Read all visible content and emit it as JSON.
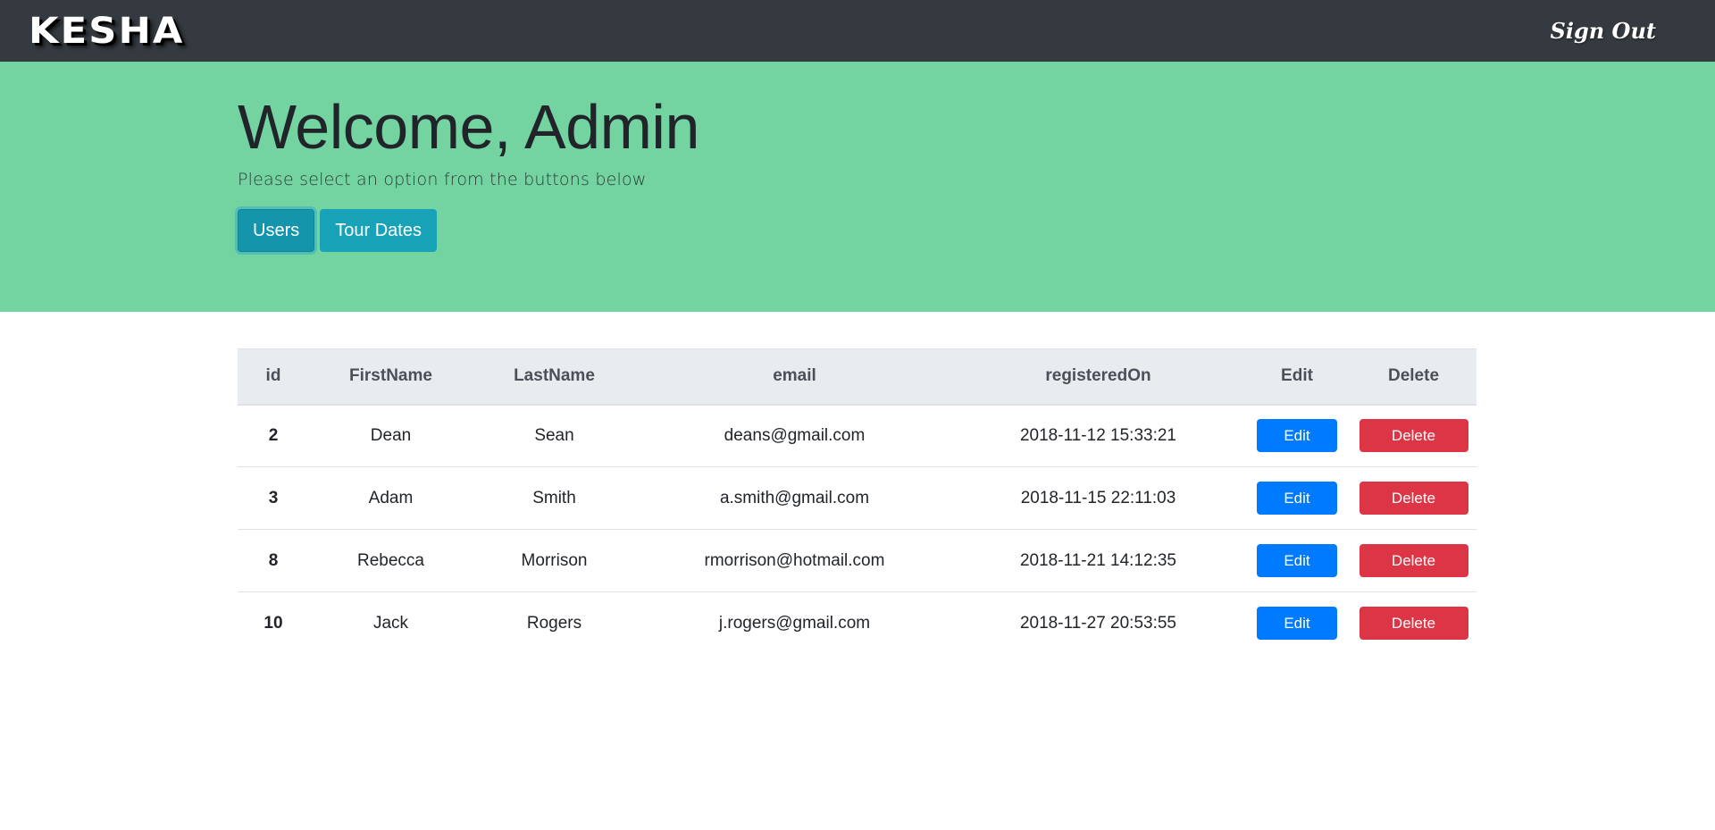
{
  "navbar": {
    "brand": "KESHA",
    "signout_label": "Sign Out"
  },
  "jumbotron": {
    "title": "Welcome, Admin",
    "subtitle": "Please select an option from the buttons below",
    "buttons": [
      {
        "label": "Users",
        "active": true
      },
      {
        "label": "Tour Dates",
        "active": false
      }
    ]
  },
  "table": {
    "headers": [
      "id",
      "FirstName",
      "LastName",
      "email",
      "registeredOn",
      "Edit",
      "Delete"
    ],
    "rows": [
      {
        "id": "2",
        "first": "Dean",
        "last": "Sean",
        "email": "deans@gmail.com",
        "registered": "2018-11-12 15:33:21",
        "edit": "Edit",
        "delete": "Delete"
      },
      {
        "id": "3",
        "first": "Adam",
        "last": "Smith",
        "email": "a.smith@gmail.com",
        "registered": "2018-11-15 22:11:03",
        "edit": "Edit",
        "delete": "Delete"
      },
      {
        "id": "8",
        "first": "Rebecca",
        "last": "Morrison",
        "email": "rmorrison@hotmail.com",
        "registered": "2018-11-21 14:12:35",
        "edit": "Edit",
        "delete": "Delete"
      },
      {
        "id": "10",
        "first": "Jack",
        "last": "Rogers",
        "email": "j.rogers@gmail.com",
        "registered": "2018-11-27 20:53:55",
        "edit": "Edit",
        "delete": "Delete"
      }
    ]
  },
  "colors": {
    "navbar": "#343a40",
    "jumbotron": "#73d4a2",
    "info": "#17a2b8",
    "primary": "#007bff",
    "danger": "#dc3545",
    "table_header": "#e9ecef"
  }
}
